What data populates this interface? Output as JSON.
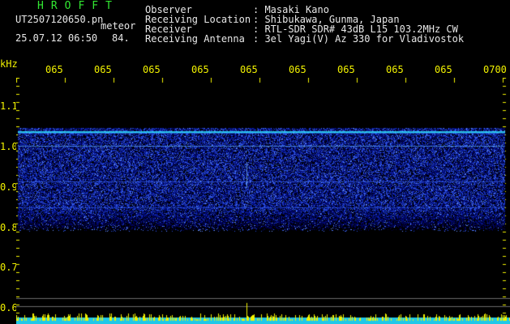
{
  "header": {
    "brand": "HROFFT",
    "file": "UT2507120650.pn",
    "meteor_label": "meteor",
    "datetime": "25.07.12 06:50",
    "count": "84.",
    "fields": [
      {
        "label": "Observer",
        "value": ": Masaki Kano"
      },
      {
        "label": "Receiving Location",
        "value": ": Shibukawa, Gunma, Japan"
      },
      {
        "label": "Receiver",
        "value": ": RTL-SDR SDR# 43dB L15 103.2MHz CW"
      },
      {
        "label": "Receiving Antenna",
        "value": ": 3el Yagi(V) Az 330 for Vladivostok"
      }
    ]
  },
  "time_axis": {
    "labels": [
      "065",
      "065",
      "065",
      "065",
      "065",
      "065",
      "065",
      "065",
      "065",
      "0700"
    ]
  },
  "freq_axis": {
    "unit": "kHz",
    "labels": [
      "1.1",
      "1.0",
      "0.9",
      "0.8",
      "0.7",
      "0.6"
    ]
  },
  "colors": {
    "text": "#e8e8e8",
    "brand": "#32e832",
    "axis": "#f2f200",
    "signal_low": "#0a14a0",
    "signal_mid": "#2050ff",
    "signal_high": "#30e0ff",
    "baseline_bar": "#20c8e8"
  }
}
